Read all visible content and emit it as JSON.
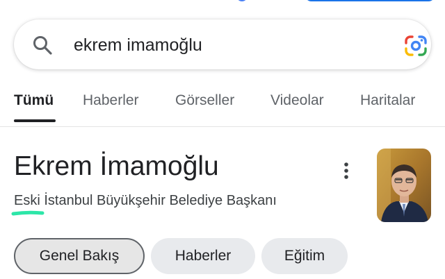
{
  "search": {
    "query": "ekrem imamoğlu"
  },
  "tabs": [
    {
      "label": "Tümü",
      "active": true
    },
    {
      "label": "Haberler",
      "active": false
    },
    {
      "label": "Görseller",
      "active": false
    },
    {
      "label": "Videolar",
      "active": false
    },
    {
      "label": "Haritalar",
      "active": false
    }
  ],
  "entity": {
    "title": "Ekrem İmamoğlu",
    "subtitle": "Eski İstanbul Büyükşehir Belediye Başkanı",
    "photo_icon": "person-photo"
  },
  "chips": [
    {
      "label": "Genel Bakış",
      "selected": true
    },
    {
      "label": "Haberler",
      "selected": false
    },
    {
      "label": "Eğitim",
      "selected": false
    }
  ],
  "colors": {
    "accent_blue": "#1a73e8",
    "highlight_green": "#2de6a8",
    "text_primary": "#202124",
    "text_secondary": "#5f6368",
    "chip_bg": "#e8eaed"
  },
  "icons": {
    "search": "search-icon",
    "lens": "google-lens-icon",
    "menu": "more-vert-icon"
  }
}
